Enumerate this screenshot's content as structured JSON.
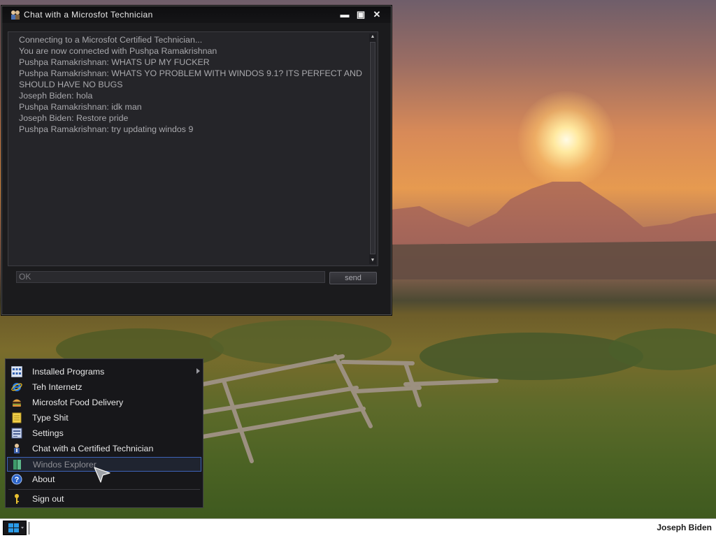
{
  "chat_window": {
    "title": "Chat with a Microsfot Technician",
    "controls": {
      "minimize": "▬",
      "maximize": "▣",
      "close": "✕"
    },
    "messages": [
      "Connecting to a Microsfot Certified Technician...",
      "You are now connected with Pushpa Ramakrishnan",
      "Pushpa Ramakrishnan: WHATS UP MY FUCKER",
      "Pushpa Ramakrishnan: WHATS YO PROBLEM WITH WINDOS 9.1? ITS PERFECT AND SHOULD HAVE NO BUGS",
      "Joseph Biden: hola",
      "Pushpa Ramakrishnan: idk man",
      "Joseph Biden: Restore pride",
      "Pushpa Ramakrishnan: try updating windos 9"
    ],
    "input": {
      "value": "OK"
    },
    "send_label": "send"
  },
  "start_menu": {
    "items": [
      {
        "label": "Installed Programs",
        "icon": "grid-icon",
        "has_submenu": true
      },
      {
        "label": "Teh Internetz",
        "icon": "internet-explorer-icon"
      },
      {
        "label": "Microsfot Food Delivery",
        "icon": "burger-icon"
      },
      {
        "label": "Type Shit",
        "icon": "notepad-icon"
      },
      {
        "label": "Settings",
        "icon": "settings-icon"
      },
      {
        "label": "Chat with a Certified Technician",
        "icon": "technician-icon"
      },
      {
        "label": "Windos Explorer",
        "icon": "book-icon",
        "hovered": true
      },
      {
        "label": "About",
        "icon": "help-icon"
      },
      {
        "label": "Sign out",
        "icon": "key-icon"
      }
    ]
  },
  "taskbar": {
    "user": "Joseph Biden"
  },
  "colors": {
    "accent": "#3d63b8",
    "window_bg": "#1b1b1d",
    "log_text": "#a8a8ac"
  }
}
